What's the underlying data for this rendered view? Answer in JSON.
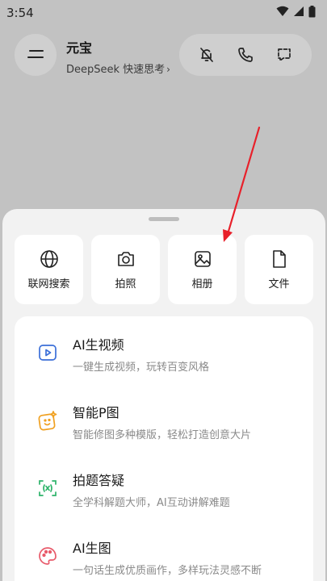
{
  "status": {
    "time": "3:54"
  },
  "header": {
    "title": "元宝",
    "subtitle": "DeepSeek 快速思考",
    "subtitle_chevron": "›"
  },
  "quick_actions": [
    {
      "label": "联网搜索",
      "icon": "globe-icon"
    },
    {
      "label": "拍照",
      "icon": "camera-icon"
    },
    {
      "label": "相册",
      "icon": "image-icon"
    },
    {
      "label": "文件",
      "icon": "file-icon"
    }
  ],
  "features": [
    {
      "title": "AI生视频",
      "desc": "一键生成视频，玩转百变风格",
      "icon": "video-play-icon",
      "color": "#3b6fd8"
    },
    {
      "title": "智能P图",
      "desc": "智能修图多种模版，轻松打造创意大片",
      "icon": "photo-edit-icon",
      "color": "#f0a020"
    },
    {
      "title": "拍题答疑",
      "desc": "全学科解题大师，AI互动讲解难题",
      "icon": "scan-formula-icon",
      "color": "#2db36a"
    },
    {
      "title": "AI生图",
      "desc": "一句话生成优质画作，多样玩法灵感不断",
      "icon": "palette-icon",
      "color": "#e85a6a"
    }
  ],
  "annotation": {
    "arrow_color": "#e8202a"
  }
}
